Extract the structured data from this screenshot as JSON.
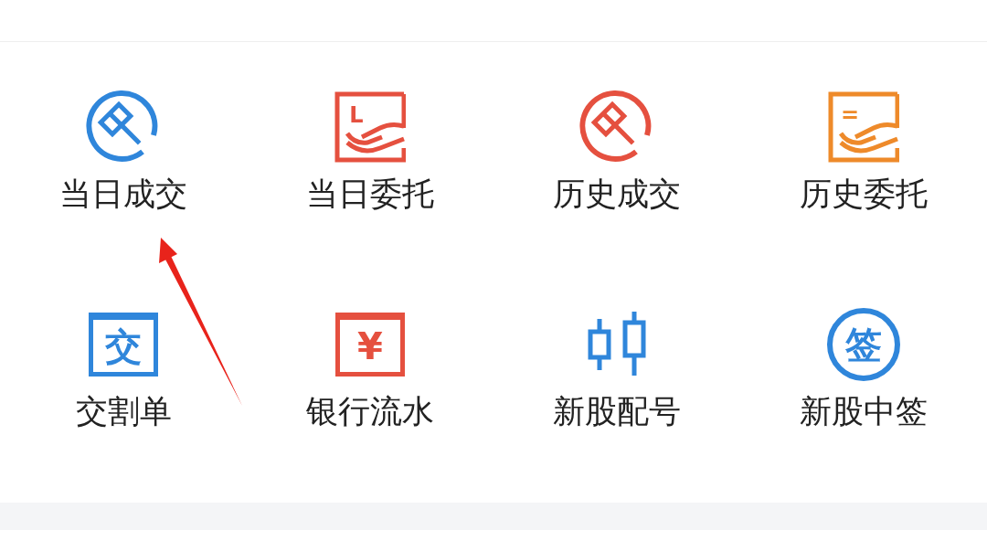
{
  "items": [
    {
      "label": "当日成交",
      "kind": "hammer-circle",
      "color": "#2f86db"
    },
    {
      "label": "当日委托",
      "kind": "hand-box",
      "color": "#e5503f",
      "mark": "L"
    },
    {
      "label": "历史成交",
      "kind": "hammer-circle",
      "color": "#e5503f"
    },
    {
      "label": "历史委托",
      "kind": "hand-box",
      "color": "#ee8a2a",
      "mark": "="
    },
    {
      "label": "交割单",
      "kind": "frame-glyph",
      "color": "#2f86db",
      "glyph": "交"
    },
    {
      "label": "银行流水",
      "kind": "frame-glyph",
      "color": "#e5503f",
      "glyph": "¥"
    },
    {
      "label": "新股配号",
      "kind": "candles",
      "color": "#2f86db"
    },
    {
      "label": "新股中签",
      "kind": "circle-glyph",
      "color": "#2f86db",
      "glyph": "签"
    }
  ]
}
